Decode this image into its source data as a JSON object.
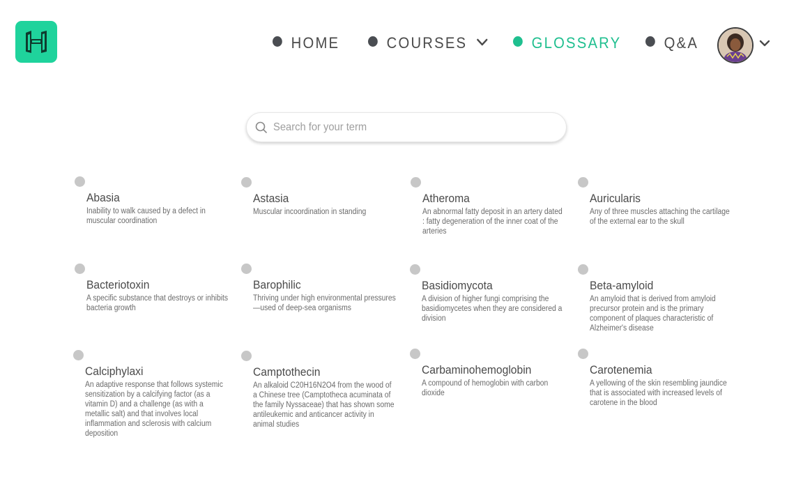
{
  "nav": {
    "items": [
      {
        "label": "HOME",
        "active": false
      },
      {
        "label": "COURSES",
        "active": false,
        "has_dropdown": true
      },
      {
        "label": "GLOSSARY",
        "active": true
      },
      {
        "label": "Q&A",
        "active": false
      }
    ]
  },
  "colors": {
    "accent": "#1fd39c",
    "active_text": "#1fbf8f",
    "dot": "#4a4d52",
    "bullet": "#c7c7c7"
  },
  "search": {
    "placeholder": "Search for your term",
    "value": ""
  },
  "terms": [
    {
      "title": "Abasia",
      "description": "Inability to walk caused by a defect in muscular coordination"
    },
    {
      "title": "Astasia",
      "description": "Muscular incoordination in standing"
    },
    {
      "title": "Atheroma",
      "description": "An abnormal fatty deposit in an artery dated : fatty degeneration of the inner coat of the arteries"
    },
    {
      "title": "Auricularis",
      "description": "Any of three muscles attaching the cartilage of the external ear to the skull"
    },
    {
      "title": "Bacteriotoxin",
      "description": "A specific substance that destroys or inhibits bacteria growth"
    },
    {
      "title": "Barophilic",
      "description": "Thriving under high environmental pressures —used of deep-sea organisms"
    },
    {
      "title": "Basidiomycota",
      "description": "A division of higher fungi comprising the basidiomycetes when they are considered a division"
    },
    {
      "title": "Beta-amyloid",
      "description": "An amyloid that is derived from amyloid precursor protein and is the primary component of plaques characteristic of Alzheimer's disease"
    },
    {
      "title": "Calciphylaxi",
      "description": "An adaptive response that follows systemic sensitization by a calcifying factor (as a vitamin D) and a challenge (as with a metallic salt) and that involves local inflammation and sclerosis with calcium deposition"
    },
    {
      "title": "Camptothecin",
      "description": "An alkaloid C20H16N2O4 from the wood of a Chinese tree (Camptotheca acuminata of the family Nyssaceae) that has shown some antileukemic and anticancer activity in animal studies"
    },
    {
      "title": "Carbaminohemoglobin",
      "description": "A compound of hemoglobin with carbon dioxide"
    },
    {
      "title": "Carotenemia",
      "description": "A yellowing of the skin resembling jaundice that is associated with increased levels of carotene in the blood"
    }
  ]
}
